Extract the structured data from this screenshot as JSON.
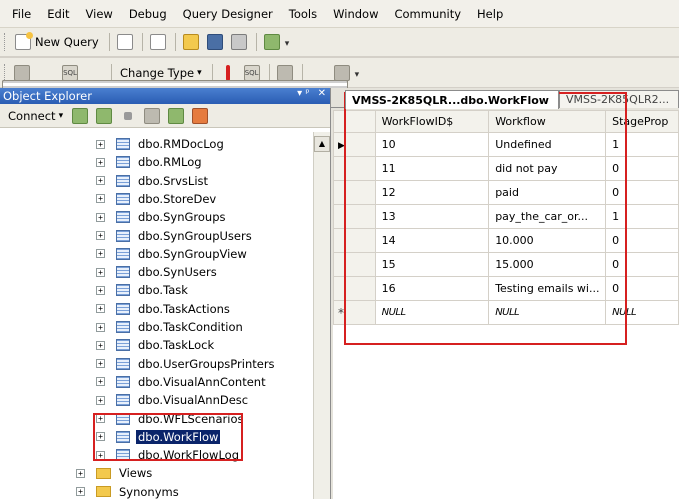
{
  "menu": [
    "File",
    "Edit",
    "View",
    "Debug",
    "Query Designer",
    "Tools",
    "Window",
    "Community",
    "Help"
  ],
  "toolbar1": {
    "new_query_label": "New Query",
    "icons": [
      "new-project-icon",
      "new-file-icon",
      "open-folder-icon",
      "save-icon",
      "print-icon",
      "report-icon"
    ]
  },
  "toolbar2": {
    "change_type_label": "Change Type",
    "dropdown_glyph": "▾"
  },
  "object_explorer": {
    "title": "Object Explorer",
    "pin_glyph": "▾ ᵖ",
    "close_glyph": "✕",
    "connect_label": "Connect",
    "tree_items": [
      {
        "label": "dbo.RMDocLog",
        "type": "table"
      },
      {
        "label": "dbo.RMLog",
        "type": "table"
      },
      {
        "label": "dbo.SrvsList",
        "type": "table"
      },
      {
        "label": "dbo.StoreDev",
        "type": "table"
      },
      {
        "label": "dbo.SynGroups",
        "type": "table"
      },
      {
        "label": "dbo.SynGroupUsers",
        "type": "table"
      },
      {
        "label": "dbo.SynGroupView",
        "type": "table"
      },
      {
        "label": "dbo.SynUsers",
        "type": "table"
      },
      {
        "label": "dbo.Task",
        "type": "table"
      },
      {
        "label": "dbo.TaskActions",
        "type": "table"
      },
      {
        "label": "dbo.TaskCondition",
        "type": "table"
      },
      {
        "label": "dbo.TaskLock",
        "type": "table"
      },
      {
        "label": "dbo.UserGroupsPrinters",
        "type": "table"
      },
      {
        "label": "dbo.VisualAnnContent",
        "type": "table"
      },
      {
        "label": "dbo.VisualAnnDesc",
        "type": "table"
      },
      {
        "label": "dbo.WFLScenarios",
        "type": "table"
      },
      {
        "label": "dbo.WorkFlow",
        "type": "table",
        "selected": true
      },
      {
        "label": "dbo.WorkFlowLog",
        "type": "table"
      }
    ],
    "folders": [
      "Views",
      "Synonyms"
    ]
  },
  "tabs": [
    {
      "label": "VMSS-2K85QLR...dbo.WorkFlow",
      "active": true
    },
    {
      "label": "VMSS-2K85QLR2...",
      "active": false
    }
  ],
  "result_grid": {
    "columns": [
      "WorkFlowID$",
      "Workflow",
      "StageProp"
    ],
    "rows": [
      {
        "cells": [
          "10",
          "Undefined",
          "1"
        ],
        "current": true
      },
      {
        "cells": [
          "11",
          "did not pay",
          "0"
        ]
      },
      {
        "cells": [
          "12",
          "paid",
          "0"
        ]
      },
      {
        "cells": [
          "13",
          "pay_the_car_or...",
          "1"
        ]
      },
      {
        "cells": [
          "14",
          "10.000",
          "0"
        ]
      },
      {
        "cells": [
          "15",
          "15.000",
          "0"
        ]
      },
      {
        "cells": [
          "16",
          "Testing emails wi...",
          "0"
        ]
      }
    ],
    "new_row": [
      "NULL",
      "NULL",
      "NULL"
    ],
    "new_row_marker": "*",
    "current_row_marker": "▶"
  },
  "highlight_color": "#d62020",
  "selection_color": "#0a246a"
}
